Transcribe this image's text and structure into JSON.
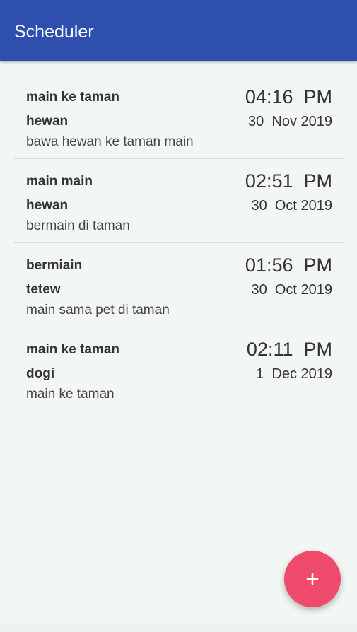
{
  "app_bar": {
    "title": "Scheduler",
    "color": "#2e4fae"
  },
  "schedules": [
    {
      "title": "main ke taman",
      "category": "hewan",
      "description": "bawa hewan ke taman main",
      "time": "04:16  PM",
      "date": "30  Nov 2019"
    },
    {
      "title": "main main",
      "category": "hewan",
      "description": "bermain di taman",
      "time": "02:51  PM",
      "date": "30  Oct 2019"
    },
    {
      "title": "bermiain",
      "category": "tetew",
      "description": "main sama pet di taman",
      "time": "01:56  PM",
      "date": "30  Oct 2019"
    },
    {
      "title": "main ke taman",
      "category": "dogi",
      "description": "main ke taman",
      "time": "02:11  PM",
      "date": "1  Dec 2019"
    }
  ],
  "fab": {
    "icon": "plus-icon",
    "color": "#ef4a6c"
  }
}
